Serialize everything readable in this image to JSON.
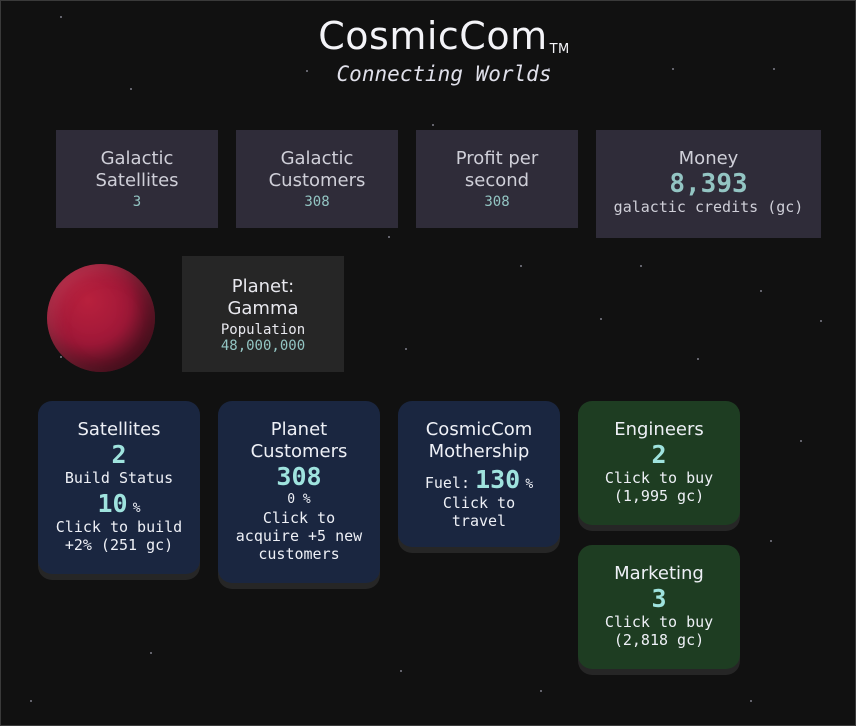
{
  "header": {
    "title": "CosmicCom",
    "trademark": "TM",
    "subtitle": "Connecting Worlds"
  },
  "stats": {
    "satellites": {
      "label": "Galactic Satellites",
      "value": "3"
    },
    "customers": {
      "label": "Galactic Customers",
      "value": "308"
    },
    "profit": {
      "label": "Profit per second",
      "value": "308"
    },
    "money": {
      "label": "Money",
      "value": "8,393",
      "unit": "galactic credits (gc)"
    }
  },
  "planet": {
    "icon": "planet-gamma-icon",
    "label": "Planet:",
    "name": "Gamma",
    "population_label": "Population",
    "population": "48,000,000"
  },
  "cards": {
    "satellites": {
      "title": "Satellites",
      "count": "2",
      "status_label": "Build Status",
      "status_value": "10",
      "status_unit": "%",
      "action": "Click to build",
      "action_detail": "+2% (251 gc)"
    },
    "customers": {
      "title_line1": "Planet",
      "title_line2": "Customers",
      "count": "308",
      "percent": "0 %",
      "action_line1": "Click to",
      "action_line2": "acquire +5 new",
      "action_line3": "customers"
    },
    "mothership": {
      "title_line1": "CosmicCom",
      "title_line2": "Mothership",
      "fuel_label": "Fuel:",
      "fuel_value": "130",
      "fuel_unit": "%",
      "action_line1": "Click to",
      "action_line2": "travel"
    },
    "engineers": {
      "title": "Engineers",
      "count": "2",
      "action": "Click to buy",
      "price": "(1,995 gc)"
    },
    "marketing": {
      "title": "Marketing",
      "count": "3",
      "action": "Click to buy",
      "price": "(2,818 gc)"
    }
  },
  "colors": {
    "background": "#111111",
    "stat_box": "#2f2c39",
    "blue_card": "#1a2640",
    "green_card": "#1e3d22",
    "accent": "#93c5c3",
    "planet": "#a01838"
  }
}
